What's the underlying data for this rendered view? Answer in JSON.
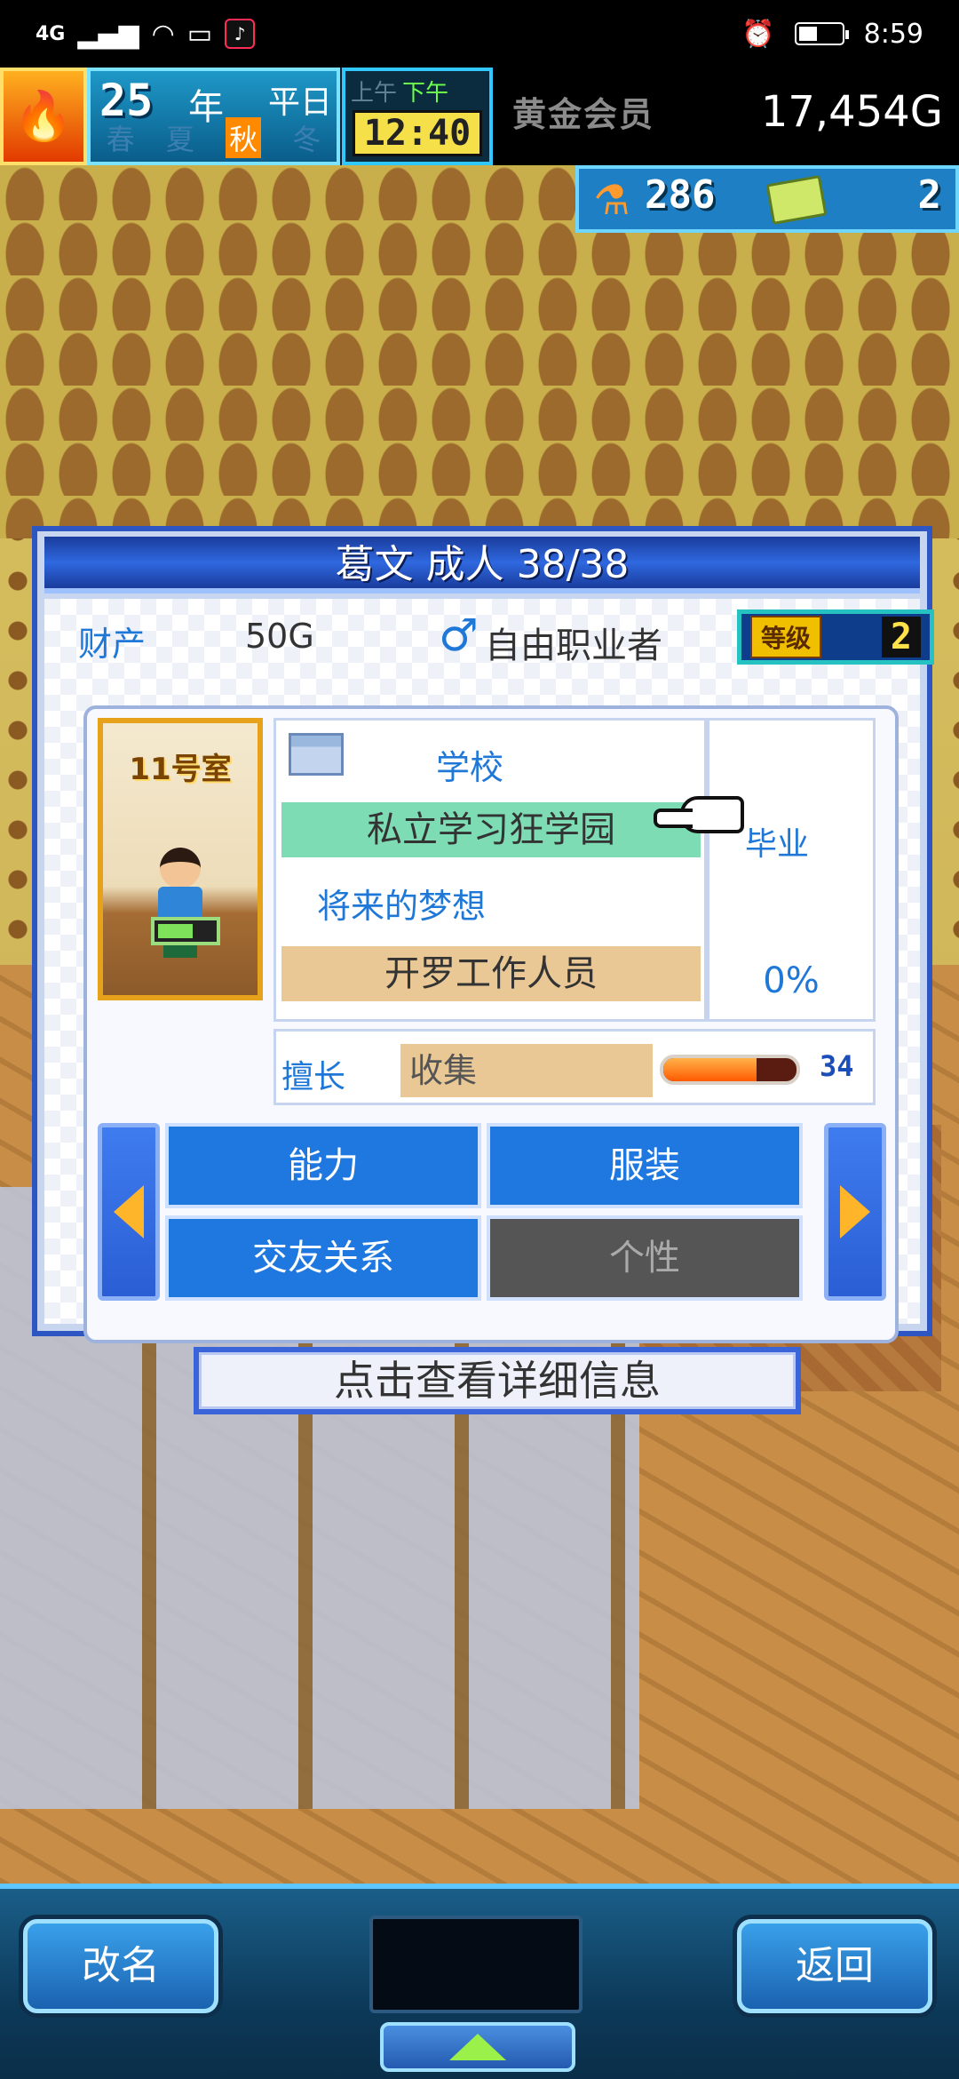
{
  "status_bar": {
    "signal": "4G",
    "time": "8:59"
  },
  "hud": {
    "year_number": "25",
    "year_label": "年",
    "season_top": "平日",
    "seasons": [
      "春",
      "夏",
      "秋",
      "冬"
    ],
    "current_season": "秋",
    "am_label": "上午",
    "pm_label": "下午",
    "clock": "12:40",
    "rank": "黄金会员",
    "money": "17,454G",
    "research_points": "286",
    "tickets": "2"
  },
  "panel": {
    "title": "葛文 成人 38/38",
    "property_label": "财产",
    "property_value": "50G",
    "job": "自由职业者",
    "level_label": "等级",
    "level_value": "2",
    "room": "11号室",
    "school_label": "学校",
    "school_value": "私立学习狂学园",
    "graduate_label": "毕业",
    "graduate_value": "0%",
    "dream_label": "将来的梦想",
    "dream_value": "开罗工作人员",
    "skill_label": "擅长",
    "skill_value": "收集",
    "skill_progress": 0.7,
    "skill_number": "34",
    "tabs": {
      "ability": "能力",
      "clothing": "服装",
      "friends": "交友关系",
      "personality": "个性"
    }
  },
  "hint": "点击查看详细信息",
  "bottom": {
    "rename": "改名",
    "back": "返回"
  }
}
